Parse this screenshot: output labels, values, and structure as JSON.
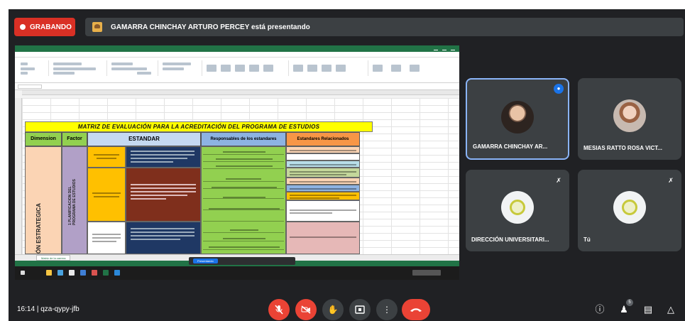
{
  "recording": {
    "label": "GRABANDO"
  },
  "presenter_bar": {
    "text": "GAMARRA CHINCHAY ARTURO PERCEY está presentando"
  },
  "shared_screen": {
    "matrix_title": "MATRIZ DE EVALUACIÓN PARA LA ACREDITACIÓN DEL PROGRAMA DE ESTUDIOS",
    "headers": {
      "dimension": "Dimension",
      "factor": "Factor",
      "estandar": "ESTANDAR",
      "responsables": "Responsables de los estandares",
      "relacionados": "Estandares Relacionados"
    },
    "dimension_text": "ÓN ESTRATEGICA",
    "factor_text": "1 PLANIFICACION DEL PROGRAMA DE ESTUDIOS",
    "sheet_tab": "Matriz de la carrera",
    "presenting_button": "Presentando"
  },
  "participants": [
    {
      "name": "GAMARRA CHINCHAY AR...",
      "speaking": true
    },
    {
      "name": "MESIAS RATTO ROSA VICT...",
      "muted": true
    },
    {
      "name": "DIRECCIÓN UNIVERSITARI...",
      "muted": true
    },
    {
      "name": "Tú",
      "muted": true
    }
  ],
  "footer": {
    "time": "16:14",
    "separator": "|",
    "meeting_code": "qza-qypy-jfb",
    "people_count": "5"
  },
  "colors": {
    "meet_bg": "#202124",
    "tile_bg": "#3c4043",
    "record_red": "#d93025",
    "excel_green": "#217346",
    "matrix_yellow": "#ffff00"
  }
}
